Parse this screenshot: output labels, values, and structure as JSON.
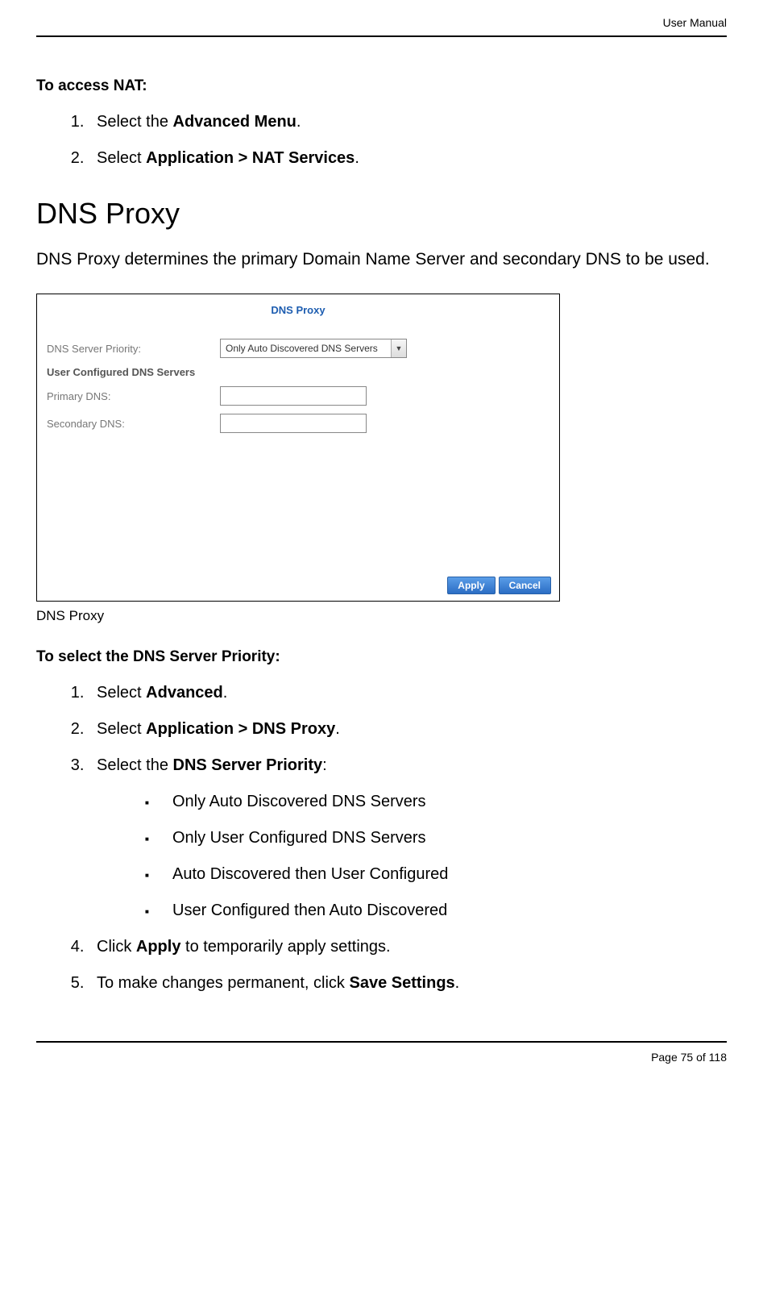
{
  "header": {
    "right": "User Manual"
  },
  "section1": {
    "heading": "To access NAT:",
    "steps": [
      {
        "prefix": "Select the ",
        "bold": "Advanced Menu",
        "suffix": "."
      },
      {
        "prefix": "Select ",
        "bold": "Application > NAT Services",
        "suffix": "."
      }
    ]
  },
  "h2": "DNS Proxy",
  "intro": "DNS Proxy determines the primary Domain Name Server and secondary DNS to be used.",
  "screenshot": {
    "title": "DNS Proxy",
    "priority_label": "DNS Server Priority:",
    "priority_value": "Only Auto Discovered DNS Servers",
    "subheader": "User Configured DNS Servers",
    "primary_label": "Primary DNS:",
    "secondary_label": "Secondary DNS:",
    "apply": "Apply",
    "cancel": "Cancel"
  },
  "caption": "DNS Proxy",
  "section2": {
    "heading": "To select the DNS Server Priority:",
    "steps": [
      {
        "prefix": "Select ",
        "bold": "Advanced",
        "suffix": "."
      },
      {
        "prefix": "Select ",
        "bold": "Application > DNS Proxy",
        "suffix": "."
      },
      {
        "prefix": "Select the ",
        "bold": "DNS Server Priority",
        "suffix": ":",
        "sublist": [
          "Only Auto Discovered DNS Servers",
          "Only User Configured DNS Servers",
          "Auto Discovered then User Configured",
          "User Configured then Auto Discovered"
        ]
      },
      {
        "prefix": "Click ",
        "bold": "Apply",
        "suffix": " to temporarily apply settings."
      },
      {
        "prefix": "To make changes permanent, click ",
        "bold": "Save Settings",
        "suffix": "."
      }
    ]
  },
  "footer": {
    "page": "Page 75 of 118"
  }
}
